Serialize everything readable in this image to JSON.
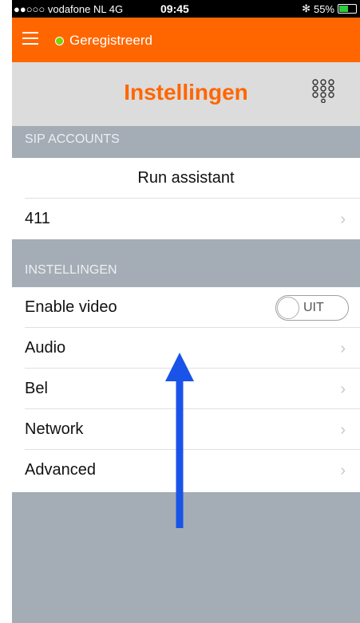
{
  "statusbar": {
    "carrier": "●●○○○ vodafone NL  4G",
    "time": "09:45",
    "bluetooth": "✻",
    "battery": "55%"
  },
  "appbar": {
    "status": "Geregistreerd",
    "status_color": "#7dd100",
    "accent": "#ff6600"
  },
  "header": {
    "title": "Instellingen"
  },
  "sections": {
    "sip": {
      "title": "SIP ACCOUNTS"
    },
    "settings": {
      "title": "INSTELLINGEN"
    }
  },
  "rows": {
    "run_assistant": "Run assistant",
    "account": "411",
    "enable_video": "Enable video",
    "video_toggle": "UIT",
    "audio": "Audio",
    "bel": "Bel",
    "network": "Network",
    "advanced": "Advanced"
  },
  "chevron": "›",
  "icons": {
    "menu": "hamburger-menu-icon",
    "dialpad": "dialpad-icon",
    "arrow": "up-arrow-annotation"
  }
}
